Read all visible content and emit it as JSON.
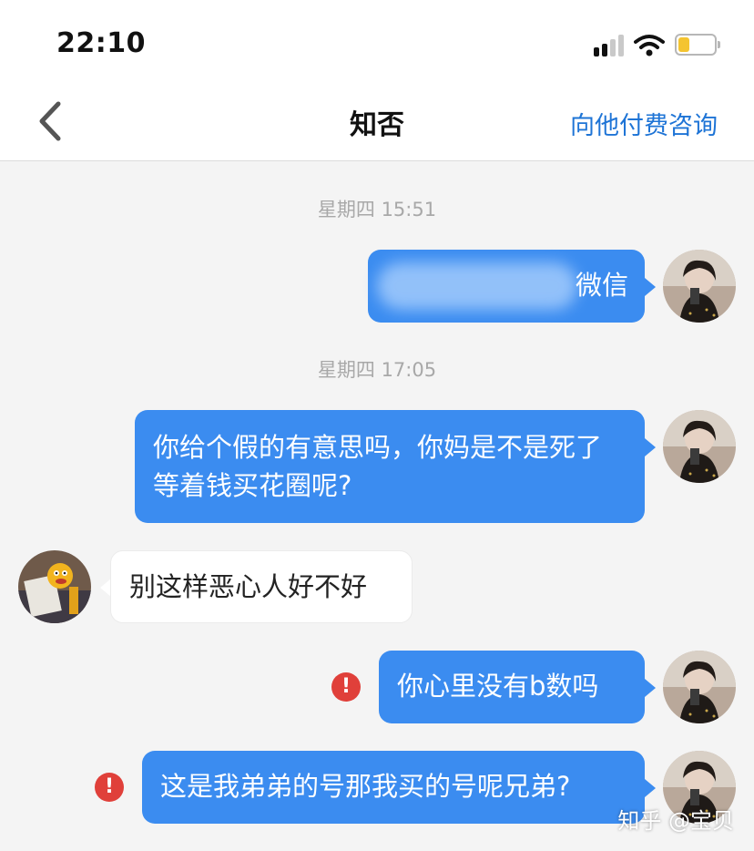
{
  "status_bar": {
    "time": "22:10",
    "icons": [
      "cellular-signal-icon",
      "wifi-icon",
      "battery-icon"
    ],
    "battery_color": "#f4c430"
  },
  "nav": {
    "back_icon": "chevron-left-icon",
    "title": "知否",
    "action_label": "向他付费咨询",
    "action_color": "#1e74d6"
  },
  "chat": {
    "timestamps": [
      "星期四 15:51",
      "星期四 17:05"
    ],
    "messages": [
      {
        "side": "out",
        "text": "微信",
        "redacted": true
      },
      {
        "side": "out",
        "text": "你给个假的有意思吗，你妈是不是死了等着钱买花圈呢?"
      },
      {
        "side": "in",
        "text": "别这样恶心人好不好"
      },
      {
        "side": "out",
        "text": "你心里没有b数吗",
        "error": true
      },
      {
        "side": "out",
        "text": "这是我弟弟的号那我买的号呢兄弟?",
        "error": true
      }
    ],
    "error_mark": "!",
    "bubble_out_color": "#3b8cf0",
    "bubble_in_color": "#ffffff",
    "error_color": "#e0403a"
  },
  "watermark": "知乎 @宝贝"
}
